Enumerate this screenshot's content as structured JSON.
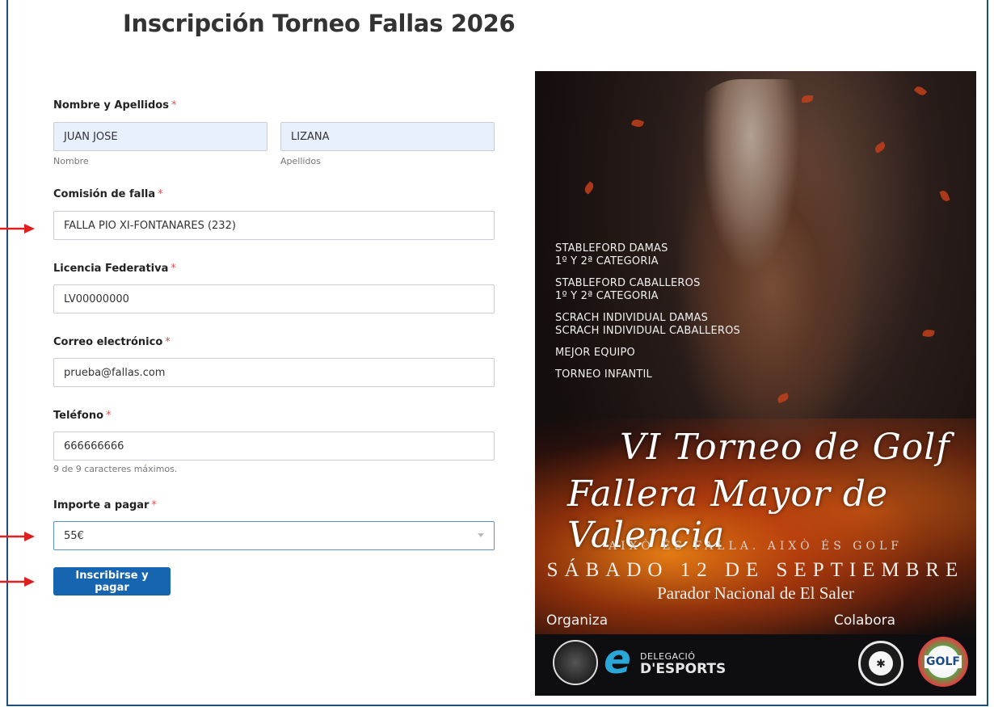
{
  "page": {
    "title": "Inscripción Torneo Fallas 2026"
  },
  "form": {
    "name": {
      "label": "Nombre y Apellidos",
      "required_mark": "*",
      "first": {
        "value": "JUAN JOSE",
        "sublabel": "Nombre"
      },
      "last": {
        "value": "LIZANA",
        "sublabel": "Apellidos"
      }
    },
    "falla": {
      "label": "Comisión de falla",
      "required_mark": "*",
      "value": "FALLA PIO XI-FONTANARES (232)"
    },
    "licence": {
      "label": "Licencia Federativa",
      "required_mark": "*",
      "value": "LV00000000"
    },
    "email": {
      "label": "Correo electrónico",
      "required_mark": "*",
      "value": "prueba@fallas.com"
    },
    "phone": {
      "label": "Teléfono",
      "required_mark": "*",
      "value": "666666666",
      "counter": "9 de 9 caracteres máximos."
    },
    "amount": {
      "label": "Importe a pagar",
      "required_mark": "*",
      "value": "55€"
    },
    "submit_label": "Inscribirse y pagar"
  },
  "poster": {
    "categories": [
      [
        "STABLEFORD DAMAS",
        "1º Y 2ª CATEGORIA"
      ],
      [
        "STABLEFORD CABALLEROS",
        "1º Y 2ª CATEGORIA"
      ],
      [
        "SCRACH INDIVIDUAL DAMAS",
        "SCRACH INDIVIDUAL CABALLEROS"
      ],
      [
        "MEJOR EQUIPO"
      ],
      [
        "TORNEO INFANTIL"
      ]
    ],
    "script_line1": "VI Torneo de Golf",
    "script_line2": "Fallera Mayor de Valencia",
    "motto": "AIXÒ ÉS FALLA. AIXÒ ÉS GOLF",
    "date": "SÁBADO 12 DE SEPTIEMBRE",
    "venue": "Parador Nacional de El Saler",
    "organiza": "Organiza",
    "colabora": "Colabora",
    "sponsor_delegacio_line1": "DELEGACIÓ",
    "sponsor_delegacio_line2": "D'ESPORTS",
    "sponsor_golf": "GOLF"
  },
  "colors": {
    "accent": "#1565b0",
    "arrow": "#e02020",
    "autofill": "#e8f0fe",
    "required": "#e05050"
  },
  "icons": [
    "red-arrow-icon",
    "select-chevron-icon"
  ]
}
